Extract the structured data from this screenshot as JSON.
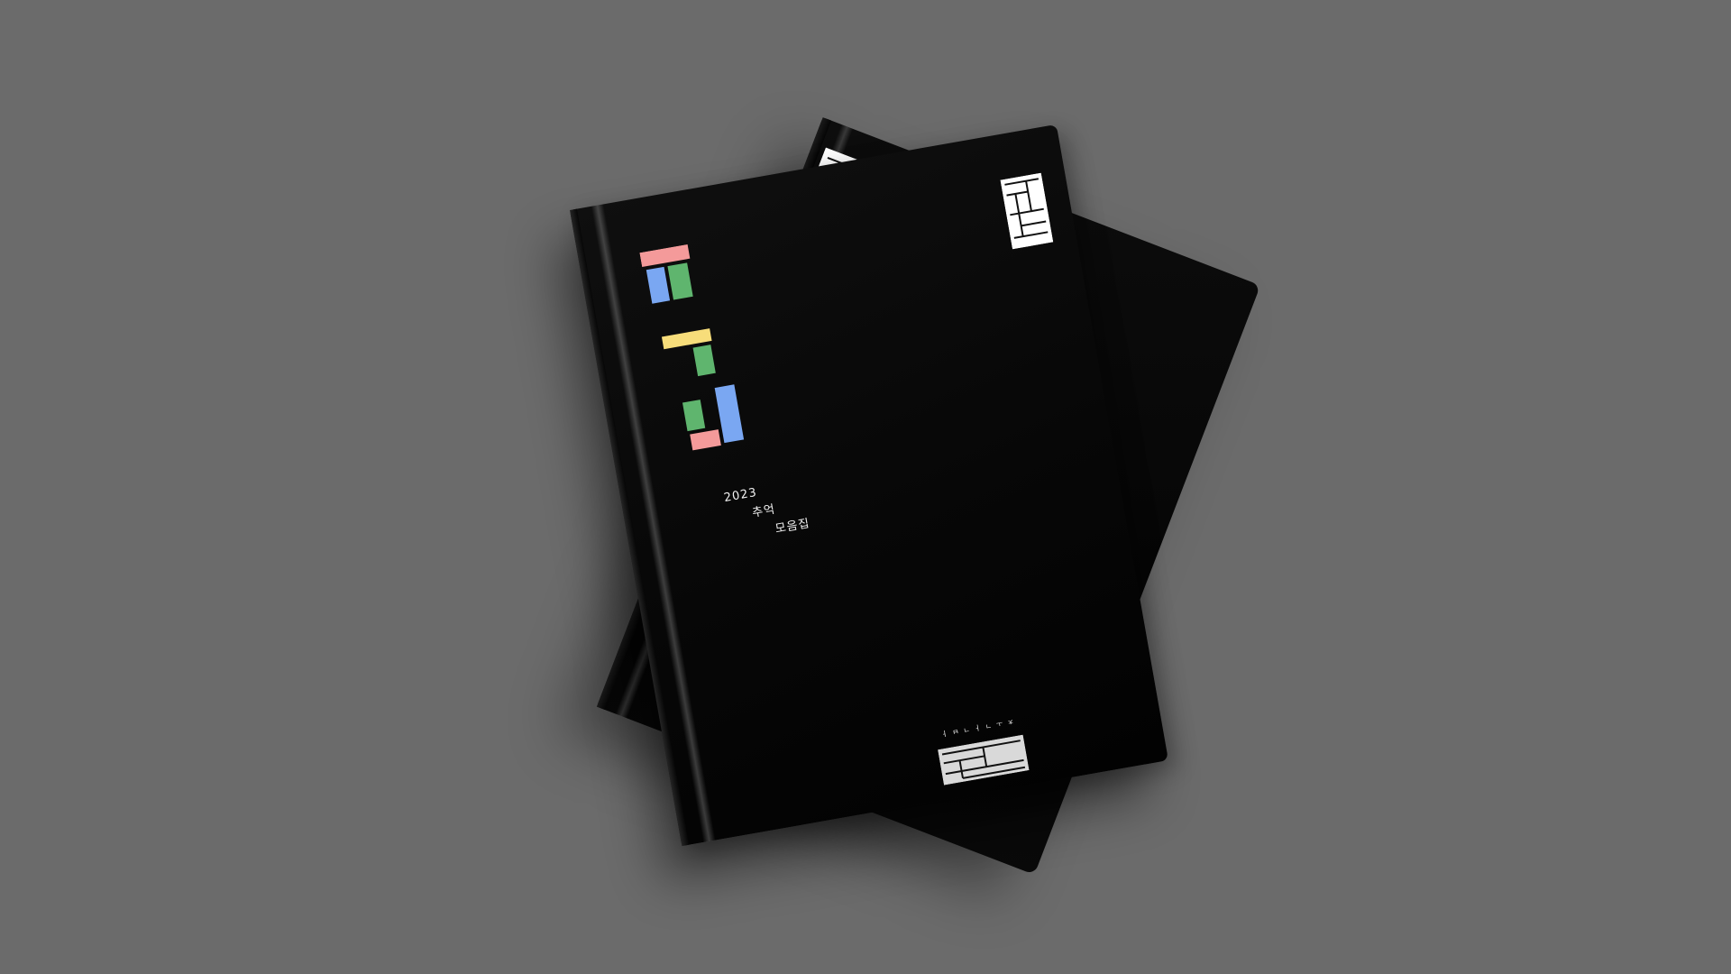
{
  "background_color": "#6b6b6b",
  "book": {
    "subtitle_lines": [
      "2023",
      "추억",
      "모음집"
    ],
    "publisher_text": "ㅊㅗㄱㅏㄱㅂㅏ",
    "logo_colors": {
      "pink": "#f49a9a",
      "blue": "#7aa7f2",
      "green": "#5fb56e",
      "yellow": "#f7dd7a"
    }
  }
}
